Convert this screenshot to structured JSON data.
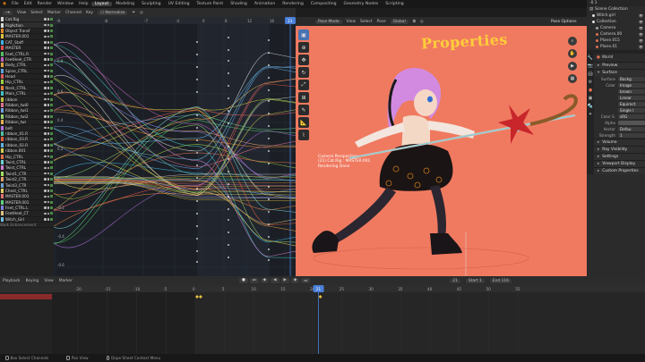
{
  "topbar": {
    "menus": [
      "File",
      "Edit",
      "Render",
      "Window",
      "Help"
    ],
    "workspaces": [
      "Layout",
      "Modeling",
      "Sculpting",
      "UV Editing",
      "Texture Paint",
      "Shading",
      "Animation",
      "Rendering",
      "Compositing",
      "Geometry Nodes",
      "Scripting"
    ],
    "active_workspace": "Layout",
    "frame_value": "-0.1"
  },
  "graph_editor": {
    "header": {
      "view": "View",
      "select": "Select",
      "marker": "Marker",
      "channel": "Channel",
      "key": "Key",
      "normalize": "Normalize"
    },
    "channels": [
      {
        "name": "Cat.Rig",
        "color": "#d8d8d8"
      },
      {
        "name": "RigAction",
        "color": "#d8d8d8"
      },
      {
        "name": "Object Transf",
        "color": "#e08a2a"
      },
      {
        "name": "MASTER.001",
        "color": "#e0c040"
      },
      {
        "name": "CAT_Staff",
        "color": "#40b0e0"
      },
      {
        "name": "MASTER",
        "color": "#e05050"
      },
      {
        "name": "Feet_CTRL.R",
        "color": "#50c060"
      },
      {
        "name": "FeetHeel_CTR",
        "color": "#c060c0"
      },
      {
        "name": "Body_CTRL",
        "color": "#e0a040"
      },
      {
        "name": "Spine_CTRL",
        "color": "#60a0e0"
      },
      {
        "name": "Head",
        "color": "#e06060"
      },
      {
        "name": "Hip_CTRL",
        "color": "#a0d040"
      },
      {
        "name": "Neck_CTRL",
        "color": "#e08040"
      },
      {
        "name": "Main_CTRL",
        "color": "#40c0c0"
      },
      {
        "name": "ribbon",
        "color": "#c0c040"
      },
      {
        "name": "Ribbon_twi0",
        "color": "#e07090"
      },
      {
        "name": "Ribbon_twi1",
        "color": "#70a0e0"
      },
      {
        "name": "Ribbon_twi2",
        "color": "#90d070"
      },
      {
        "name": "Ribbon_twi",
        "color": "#e0b050"
      },
      {
        "name": "belt",
        "color": "#b070e0"
      },
      {
        "name": "ribbon_01.R",
        "color": "#50c0a0"
      },
      {
        "name": "ribbon_03.R",
        "color": "#e06040"
      },
      {
        "name": "ribbon_02.R",
        "color": "#60b0e0"
      },
      {
        "name": "ribbon.001",
        "color": "#d0d050"
      },
      {
        "name": "Hip_CTRL",
        "color": "#e07050"
      },
      {
        "name": "Twist_CTRL",
        "color": "#70d0d0"
      },
      {
        "name": "Twist_CTRL",
        "color": "#d080d0"
      },
      {
        "name": "Twist1_CTR",
        "color": "#a0e060"
      },
      {
        "name": "Twist2_CTR",
        "color": "#e0a070"
      },
      {
        "name": "Twist3_CTR",
        "color": "#70a0d0"
      },
      {
        "name": "Chest_CTRL",
        "color": "#e0d060"
      },
      {
        "name": "MASTER.001",
        "color": "#e07070"
      },
      {
        "name": "MASTER.001",
        "color": "#60d080"
      },
      {
        "name": "Feet_CTRL.L",
        "color": "#8080e0"
      },
      {
        "name": "FeetHeel_CT",
        "color": "#e0c080"
      },
      {
        "name": "Witch_Girl",
        "color": "#70c0e0"
      }
    ],
    "footer_text": "Walk Enhancement",
    "frame_ticks": [
      "-9",
      "-8",
      "-7",
      "-4",
      "0",
      "8",
      "12",
      "16",
      "18",
      "21"
    ],
    "value_labels": [
      "0.8",
      "0.6",
      "0.4",
      "0.2",
      "0",
      "-0.2",
      "-0.4",
      "-0.6"
    ],
    "current_frame": 21
  },
  "viewport": {
    "header": {
      "mode": "Pose Mode",
      "view": "View",
      "select": "Select",
      "pose": "Pose",
      "transform": "Global"
    },
    "pose_options": "Pose Options",
    "overlay_title": "Properties",
    "info_lines": [
      "Camera Perspective",
      "(21) Cat.Rig : MASTER.001",
      "Rendering Done"
    ],
    "background_color": "#f07a60"
  },
  "outliner": {
    "header": "Scene Collection",
    "items": [
      {
        "name": "Witch.girl",
        "color": "#e0e0e0"
      },
      {
        "name": "Collection",
        "color": "#e0e0e0"
      },
      {
        "name": "Camera",
        "color": "#a0a0a0"
      },
      {
        "name": "Camera.00",
        "color": "#e07050"
      },
      {
        "name": "Plane.015",
        "color": "#e07050"
      },
      {
        "name": "Plane.01",
        "color": "#e07050"
      }
    ]
  },
  "properties": {
    "world_name": "World",
    "sections": {
      "preview": "Preview",
      "surface": "Surface",
      "volume": "Volume",
      "ray_visibility": "Ray Visibility",
      "settings": "Settings",
      "viewport_display": "Viewport Display",
      "custom_properties": "Custom Properties"
    },
    "fields": [
      {
        "label": "Surface",
        "value": "Backg"
      },
      {
        "label": "Color",
        "value": "Image"
      },
      {
        "label": "",
        "value": "brown."
      },
      {
        "label": "",
        "value": "Linear"
      },
      {
        "label": "",
        "value": "Equirect"
      },
      {
        "label": "",
        "value": "Single I"
      },
      {
        "label": "Color S.",
        "value": "sRG"
      },
      {
        "label": "Alpha",
        "value": ""
      },
      {
        "label": "Vector",
        "value": "Defau"
      },
      {
        "label": "Strength",
        "value": "1"
      }
    ]
  },
  "dopesheet": {
    "header": {
      "playback": "Playback",
      "keying": "Keying",
      "view": "View",
      "marker": "Marker"
    },
    "current_frame": 21,
    "start_label": "Start",
    "start_value": "1",
    "end_label": "End",
    "end_value": "116",
    "ruler_ticks": [
      "-20",
      "-15",
      "-10",
      "-5",
      "0",
      "5",
      "10",
      "15",
      "20",
      "25",
      "30",
      "35",
      "40",
      "45",
      "50",
      "55"
    ]
  },
  "statusbar": {
    "items": [
      "Box Select Channels",
      "Pan View",
      "Dope Sheet Context Menu"
    ]
  },
  "colors": {
    "accent": "#4772b3",
    "playhead": "#4a7fd8",
    "keyframe": "#e8c040"
  }
}
